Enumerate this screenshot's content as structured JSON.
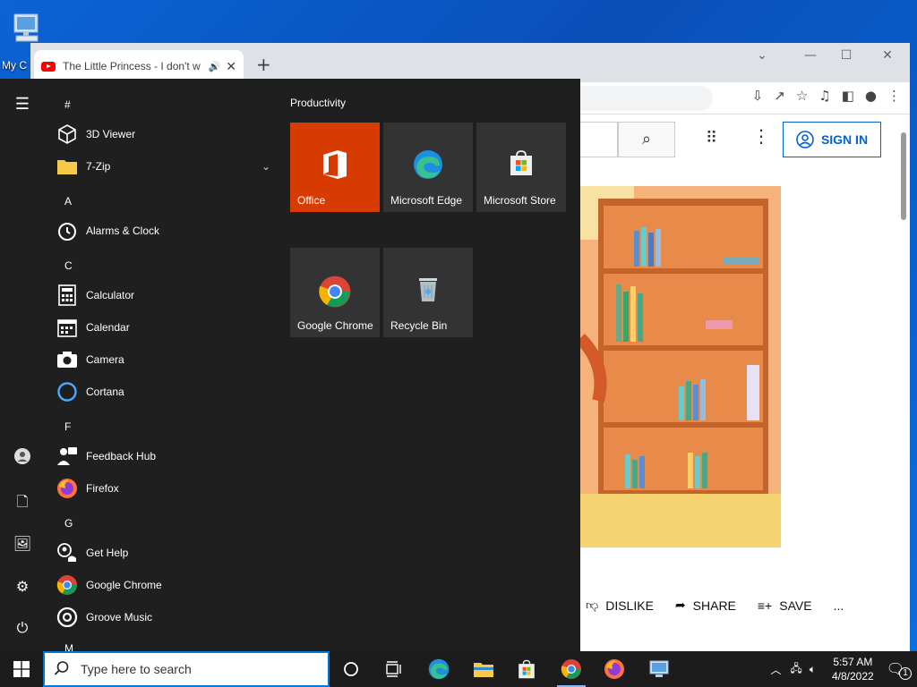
{
  "desktop": {
    "icon_label": "My C"
  },
  "browser": {
    "tab_title": "The Little Princess - I don't w",
    "tab_audio_icon": "speaker-icon",
    "new_tab_label": "+",
    "signin_label": "SIGN IN",
    "actions": {
      "dislike": "DISLIKE",
      "share": "SHARE",
      "save": "SAVE",
      "more": "..."
    }
  },
  "start_menu": {
    "tiles_group": "Productivity",
    "tiles": [
      {
        "label": "Office",
        "color": "#d83b01"
      },
      {
        "label": "Microsoft Edge",
        "color": "#333333"
      },
      {
        "label": "Microsoft Store",
        "color": "#333333"
      },
      {
        "label": "Google Chrome",
        "color": "#333333"
      },
      {
        "label": "Recycle Bin",
        "color": "#333333"
      }
    ],
    "apps": {
      "hash": "#",
      "viewer3d": "3D Viewer",
      "zip": "7-Zip",
      "A": "A",
      "alarms": "Alarms & Clock",
      "C": "C",
      "calculator": "Calculator",
      "calendar": "Calendar",
      "camera": "Camera",
      "cortana": "Cortana",
      "F": "F",
      "feedback": "Feedback Hub",
      "firefox": "Firefox",
      "G": "G",
      "gethelp": "Get Help",
      "chrome": "Google Chrome",
      "groove": "Groove Music",
      "M": "M"
    }
  },
  "taskbar": {
    "search_placeholder": "Type here to search",
    "time": "5:57 AM",
    "date": "4/8/2022",
    "notification_count": "1"
  },
  "colors": {
    "accent": "#0078d7",
    "youtube_blue": "#065fd4",
    "office": "#d83b01"
  }
}
